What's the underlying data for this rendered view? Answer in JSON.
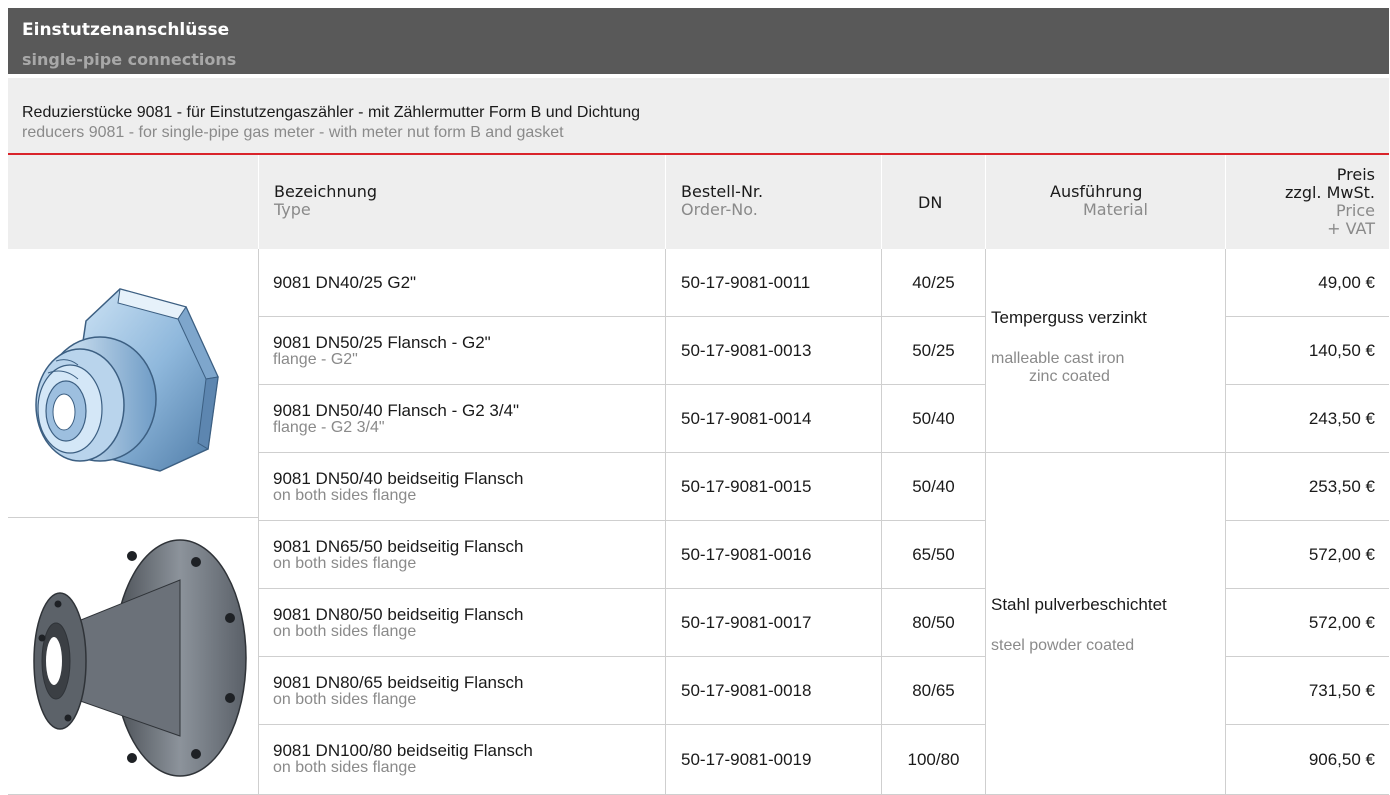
{
  "header": {
    "title": "Einstutzenanschlüsse",
    "subtitle": "single-pipe connections"
  },
  "section": {
    "title_de": "Reduzierstücke 9081 - für Einstutzengaszähler - mit Zählermutter Form B und Dichtung",
    "title_en": "reducers 9081 - for single-pipe gas meter - with meter nut form B and gasket"
  },
  "columns": {
    "type_de": "Bezeichnung",
    "type_en": "Type",
    "order_de": "Bestell-Nr.",
    "order_en": "Order-No.",
    "dn": "DN",
    "material_de": "Ausführung",
    "material_en": "Material",
    "price_de_1": "Preis",
    "price_de_2": "zzgl. MwSt.",
    "price_en_1": "Price",
    "price_en_2": "+ VAT"
  },
  "images": [
    {
      "alt": "malleable cast iron reducer with hex meter nut"
    },
    {
      "alt": "powder coated steel flanged reducer"
    }
  ],
  "materials": [
    {
      "de": "Temperguss verzinkt",
      "en_1": "malleable cast iron",
      "en_2": "zinc coated"
    },
    {
      "de": "Stahl pulverbeschichtet",
      "en_1": "steel powder coated"
    }
  ],
  "rows": [
    {
      "type_de": "9081 DN40/25 G2\"",
      "type_en": "",
      "order": "50-17-9081-0011",
      "dn": "40/25",
      "price": "49,00 €"
    },
    {
      "type_de": "9081 DN50/25 Flansch - G2\"",
      "type_en": "flange - G2\"",
      "order": "50-17-9081-0013",
      "dn": "50/25",
      "price": "140,50 €"
    },
    {
      "type_de": "9081 DN50/40 Flansch - G2 3/4\"",
      "type_en": "flange - G2 3/4\"",
      "order": "50-17-9081-0014",
      "dn": "50/40",
      "price": "243,50 €"
    },
    {
      "type_de": "9081 DN50/40 beidseitig Flansch",
      "type_en": "on both sides flange",
      "order": "50-17-9081-0015",
      "dn": "50/40",
      "price": "253,50 €"
    },
    {
      "type_de": "9081 DN65/50 beidseitig Flansch",
      "type_en": "on both sides flange",
      "order": "50-17-9081-0016",
      "dn": "65/50",
      "price": "572,00 €"
    },
    {
      "type_de": "9081 DN80/50 beidseitig Flansch",
      "type_en": "on both sides flange",
      "order": "50-17-9081-0017",
      "dn": "80/50",
      "price": "572,00 €"
    },
    {
      "type_de": "9081 DN80/65 beidseitig Flansch",
      "type_en": "on both sides flange",
      "order": "50-17-9081-0018",
      "dn": "80/65",
      "price": "731,50 €"
    },
    {
      "type_de": "9081 DN100/80 beidseitig Flansch",
      "type_en": "on both sides flange",
      "order": "50-17-9081-0019",
      "dn": "100/80",
      "price": "906,50 €"
    }
  ]
}
